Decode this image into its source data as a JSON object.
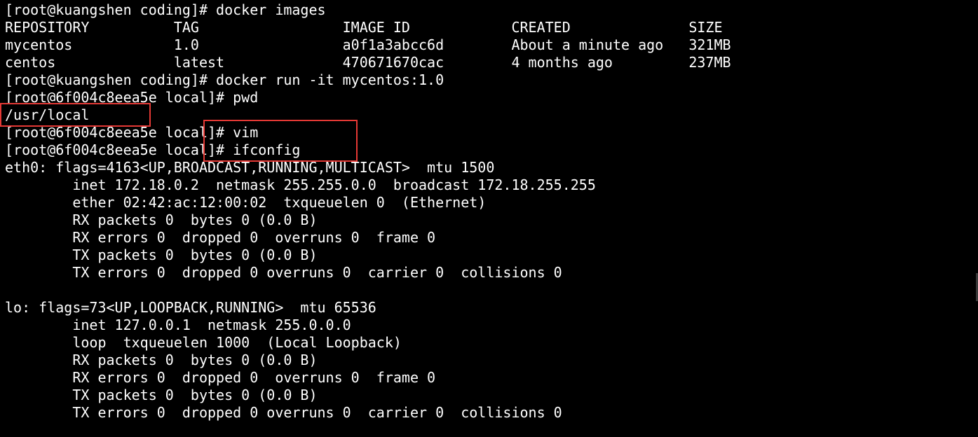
{
  "terminal": {
    "lines": [
      "[root@kuangshen coding]# docker images",
      "REPOSITORY          TAG                 IMAGE ID            CREATED              SIZE",
      "mycentos            1.0                 a0f1a3abcc6d        About a minute ago   321MB",
      "centos              latest              470671670cac        4 months ago         237MB",
      "[root@kuangshen coding]# docker run -it mycentos:1.0",
      "[root@6f004c8eea5e local]# pwd",
      "/usr/local",
      "[root@6f004c8eea5e local]# vim",
      "[root@6f004c8eea5e local]# ifconfig",
      "eth0: flags=4163<UP,BROADCAST,RUNNING,MULTICAST>  mtu 1500",
      "        inet 172.18.0.2  netmask 255.255.0.0  broadcast 172.18.255.255",
      "        ether 02:42:ac:12:00:02  txqueuelen 0  (Ethernet)",
      "        RX packets 0  bytes 0 (0.0 B)",
      "        RX errors 0  dropped 0  overruns 0  frame 0",
      "        TX packets 0  bytes 0 (0.0 B)",
      "        TX errors 0  dropped 0 overruns 0  carrier 0  collisions 0",
      "",
      "lo: flags=73<UP,LOOPBACK,RUNNING>  mtu 65536",
      "        inet 127.0.0.1  netmask 255.0.0.0",
      "        loop  txqueuelen 1000  (Local Loopback)",
      "        RX packets 0  bytes 0 (0.0 B)",
      "        RX errors 0  dropped 0  overruns 0  frame 0",
      "        TX packets 0  bytes 0 (0.0 B)",
      "        TX errors 0  dropped 0 overruns 0  carrier 0  collisions 0"
    ]
  },
  "colors": {
    "background": "#000000",
    "text": "#ffffff",
    "highlight": "#e53935"
  }
}
